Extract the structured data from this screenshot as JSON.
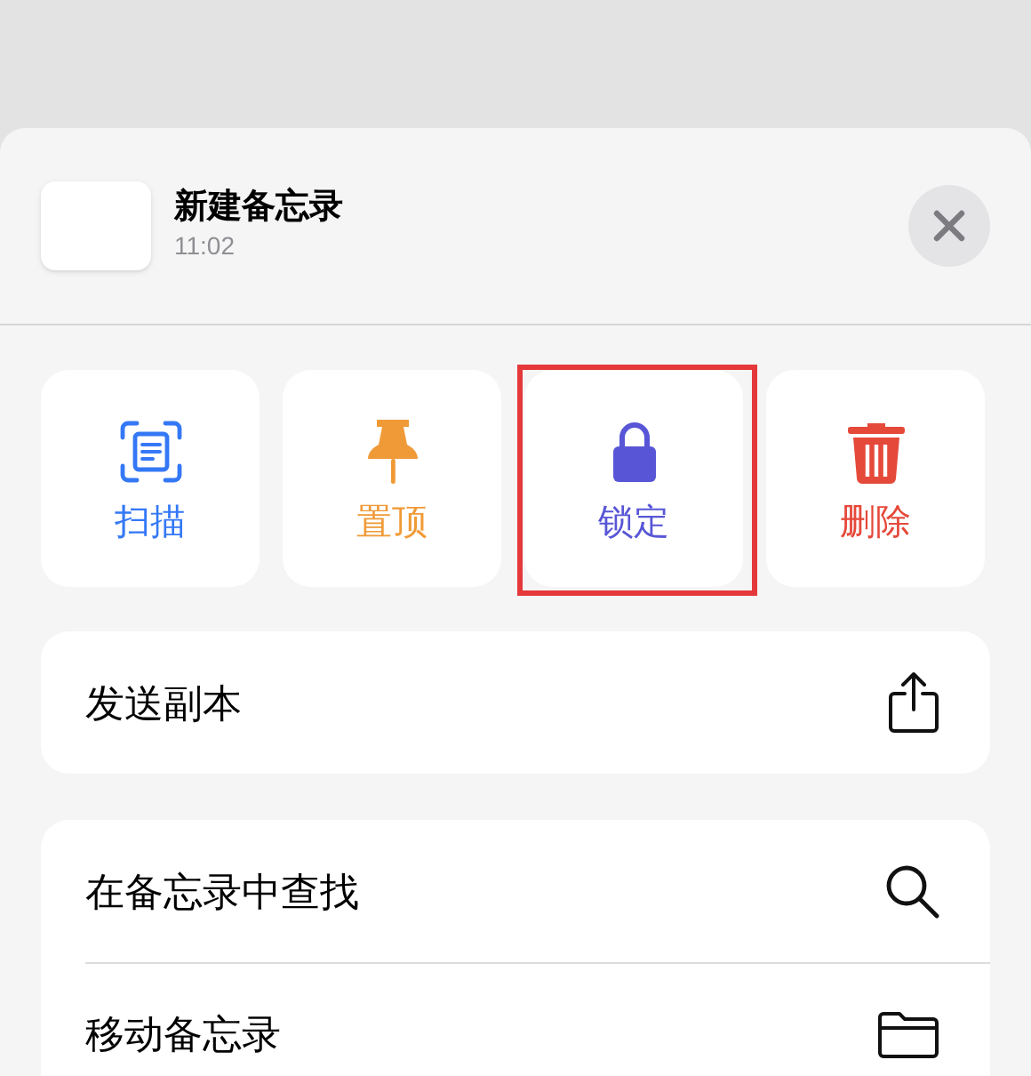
{
  "note": {
    "title": "新建备忘录",
    "time": "11:02"
  },
  "actions": [
    {
      "kind": "scan",
      "label": "扫描",
      "color": "#3478f6",
      "highlighted": false
    },
    {
      "kind": "pin",
      "label": "置顶",
      "color": "#f09a37",
      "highlighted": false
    },
    {
      "kind": "lock",
      "label": "锁定",
      "color": "#5856d6",
      "highlighted": true
    },
    {
      "kind": "trash",
      "label": "删除",
      "color": "#e5493a",
      "highlighted": false
    }
  ],
  "groups": [
    [
      {
        "kind": "share",
        "label": "发送副本"
      }
    ],
    [
      {
        "kind": "search",
        "label": "在备忘录中查找"
      },
      {
        "kind": "folder",
        "label": "移动备忘录"
      }
    ]
  ]
}
